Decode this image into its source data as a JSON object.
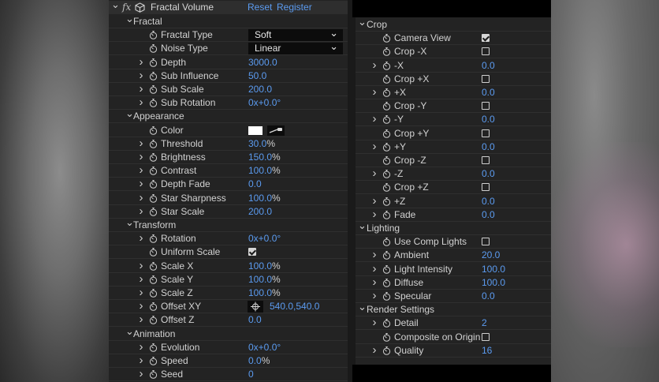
{
  "effect": {
    "name": "Fractal Volume",
    "fx_label": "fx",
    "reset_label": "Reset",
    "register_label": "Register"
  },
  "left_rows": [
    {
      "kind": "group",
      "label": "Fractal"
    },
    {
      "kind": "dropdown",
      "label": "Fractal Type",
      "value": "Soft"
    },
    {
      "kind": "dropdown",
      "label": "Noise Type",
      "value": "Linear"
    },
    {
      "kind": "value",
      "label": "Depth",
      "value": "3000.0",
      "unit": ""
    },
    {
      "kind": "value",
      "label": "Sub Influence",
      "value": "50.0",
      "unit": ""
    },
    {
      "kind": "value",
      "label": "Sub Scale",
      "value": "200.0",
      "unit": ""
    },
    {
      "kind": "value",
      "label": "Sub Rotation",
      "value": "0x+0.0°",
      "unit": ""
    },
    {
      "kind": "group",
      "label": "Appearance"
    },
    {
      "kind": "color",
      "label": "Color",
      "value": "#ffffff"
    },
    {
      "kind": "value",
      "label": "Threshold",
      "value": "30.0",
      "unit": "%"
    },
    {
      "kind": "value",
      "label": "Brightness",
      "value": "150.0",
      "unit": "%"
    },
    {
      "kind": "value",
      "label": "Contrast",
      "value": "100.0",
      "unit": "%"
    },
    {
      "kind": "value",
      "label": "Depth Fade",
      "value": "0.0",
      "unit": ""
    },
    {
      "kind": "value",
      "label": "Star Sharpness",
      "value": "100.0",
      "unit": "%"
    },
    {
      "kind": "value",
      "label": "Star Scale",
      "value": "200.0",
      "unit": ""
    },
    {
      "kind": "group",
      "label": "Transform"
    },
    {
      "kind": "value",
      "label": "Rotation",
      "value": "0x+0.0°",
      "unit": ""
    },
    {
      "kind": "checkbox",
      "label": "Uniform Scale",
      "checked": true
    },
    {
      "kind": "value",
      "label": "Scale X",
      "value": "100.0",
      "unit": "%"
    },
    {
      "kind": "value",
      "label": "Scale Y",
      "value": "100.0",
      "unit": "%"
    },
    {
      "kind": "value",
      "label": "Scale Z",
      "value": "100.0",
      "unit": "%"
    },
    {
      "kind": "point",
      "label": "Offset XY",
      "value": "540.0,540.0"
    },
    {
      "kind": "value",
      "label": "Offset Z",
      "value": "0.0",
      "unit": ""
    },
    {
      "kind": "group",
      "label": "Animation"
    },
    {
      "kind": "value",
      "label": "Evolution",
      "value": "0x+0.0°",
      "unit": ""
    },
    {
      "kind": "value",
      "label": "Speed",
      "value": "0.0",
      "unit": "%"
    },
    {
      "kind": "value",
      "label": "Seed",
      "value": "0",
      "unit": ""
    }
  ],
  "right_rows": [
    {
      "kind": "group",
      "label": "Crop"
    },
    {
      "kind": "checkbox",
      "label": "Camera View",
      "checked": true
    },
    {
      "kind": "checkbox",
      "label": "Crop -X",
      "checked": false
    },
    {
      "kind": "value",
      "label": "-X",
      "value": "0.0",
      "unit": ""
    },
    {
      "kind": "checkbox",
      "label": "Crop +X",
      "checked": false
    },
    {
      "kind": "value",
      "label": "+X",
      "value": "0.0",
      "unit": ""
    },
    {
      "kind": "checkbox",
      "label": "Crop -Y",
      "checked": false
    },
    {
      "kind": "value",
      "label": "-Y",
      "value": "0.0",
      "unit": ""
    },
    {
      "kind": "checkbox",
      "label": "Crop +Y",
      "checked": false
    },
    {
      "kind": "value",
      "label": "+Y",
      "value": "0.0",
      "unit": ""
    },
    {
      "kind": "checkbox",
      "label": "Crop -Z",
      "checked": false
    },
    {
      "kind": "value",
      "label": "-Z",
      "value": "0.0",
      "unit": ""
    },
    {
      "kind": "checkbox",
      "label": "Crop +Z",
      "checked": false
    },
    {
      "kind": "value",
      "label": "+Z",
      "value": "0.0",
      "unit": ""
    },
    {
      "kind": "value",
      "label": "Fade",
      "value": "0.0",
      "unit": ""
    },
    {
      "kind": "group",
      "label": "Lighting"
    },
    {
      "kind": "checkbox",
      "label": "Use Comp Lights",
      "checked": false
    },
    {
      "kind": "value",
      "label": "Ambient",
      "value": "20.0",
      "unit": ""
    },
    {
      "kind": "value",
      "label": "Light Intensity",
      "value": "100.0",
      "unit": ""
    },
    {
      "kind": "value",
      "label": "Diffuse",
      "value": "100.0",
      "unit": ""
    },
    {
      "kind": "value",
      "label": "Specular",
      "value": "0.0",
      "unit": ""
    },
    {
      "kind": "group",
      "label": "Render Settings"
    },
    {
      "kind": "value",
      "label": "Detail",
      "value": "2",
      "unit": ""
    },
    {
      "kind": "checkbox",
      "label": "Composite on Origin",
      "checked": false
    },
    {
      "kind": "value",
      "label": "Quality",
      "value": "16",
      "unit": ""
    }
  ],
  "icons": {
    "stopwatch": "stopwatch-icon",
    "disclosure_open": "chevron-down-icon",
    "disclosure_closed": "chevron-right-icon",
    "effect": "cube-icon",
    "eyedropper": "eyedropper-icon",
    "crosshair": "crosshair-icon"
  },
  "colors": {
    "accent": "#5b9bf0",
    "panel": "#232323"
  }
}
